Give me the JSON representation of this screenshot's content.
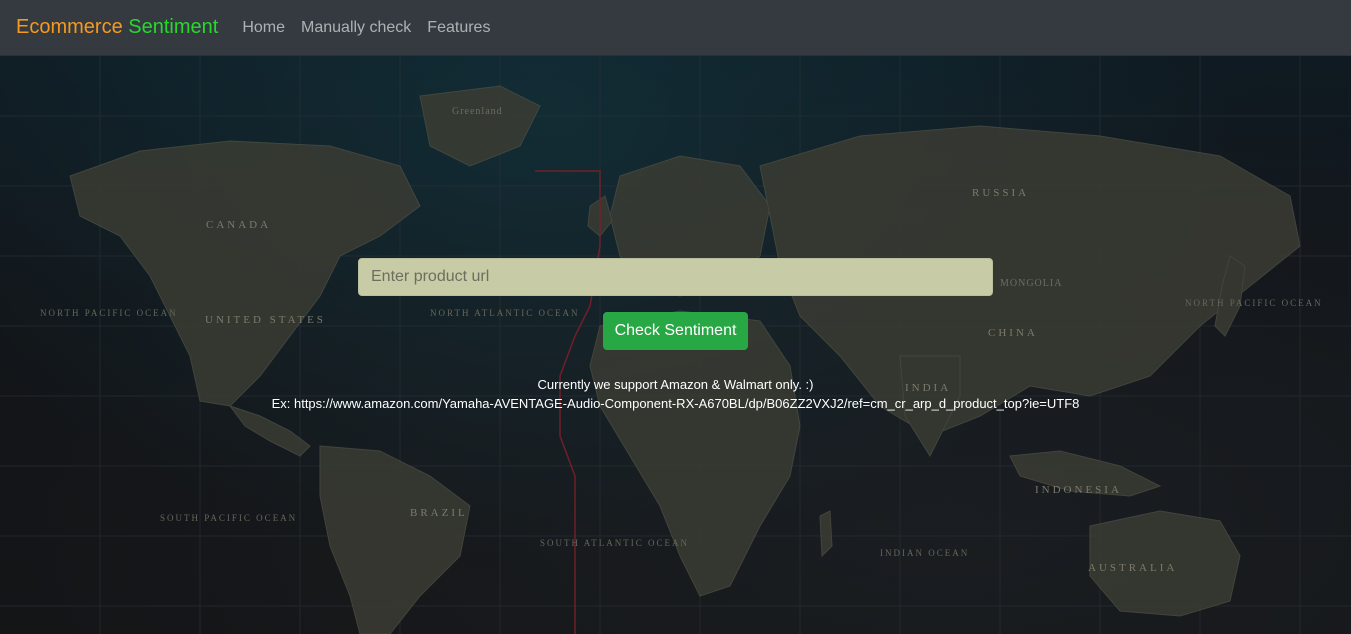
{
  "navbar": {
    "brand_part1": "Ecommerce",
    "brand_part2": "Sentiment",
    "links": [
      "Home",
      "Manually check",
      "Features"
    ]
  },
  "form": {
    "url_placeholder": "Enter product url",
    "url_value": "",
    "check_button_label": "Check Sentiment"
  },
  "info": {
    "support": "Currently we support Amazon & Walmart only. :)",
    "example": "Ex: https://www.amazon.com/Yamaha-AVENTAGE-Audio-Component-RX-A670BL/dp/B06ZZ2VXJ2/ref=cm_cr_arp_d_product_top?ie=UTF8"
  },
  "map_labels": {
    "canada": "CANADA",
    "united_states": "UNITED STATES",
    "russia": "RUSSIA",
    "china": "CHINA",
    "brazil": "BRAZIL",
    "australia": "AUSTRALIA",
    "indonesia": "INDONESIA",
    "india": "INDIA",
    "greenland": "Greenland",
    "mongolia": "MONGOLIA",
    "north_pacific_left": "NORTH PACIFIC OCEAN",
    "north_pacific_right": "NORTH PACIFIC OCEAN",
    "north_atlantic": "NORTH ATLANTIC OCEAN",
    "south_pacific": "SOUTH PACIFIC OCEAN",
    "south_atlantic": "SOUTH ATLANTIC OCEAN",
    "indian_ocean": "INDIAN OCEAN"
  },
  "colors": {
    "navbar_bg": "#343a40",
    "brand_orange": "#f59a1e",
    "brand_green": "#28d82d",
    "button_green": "#28a745",
    "input_bg": "#c7cba6"
  }
}
